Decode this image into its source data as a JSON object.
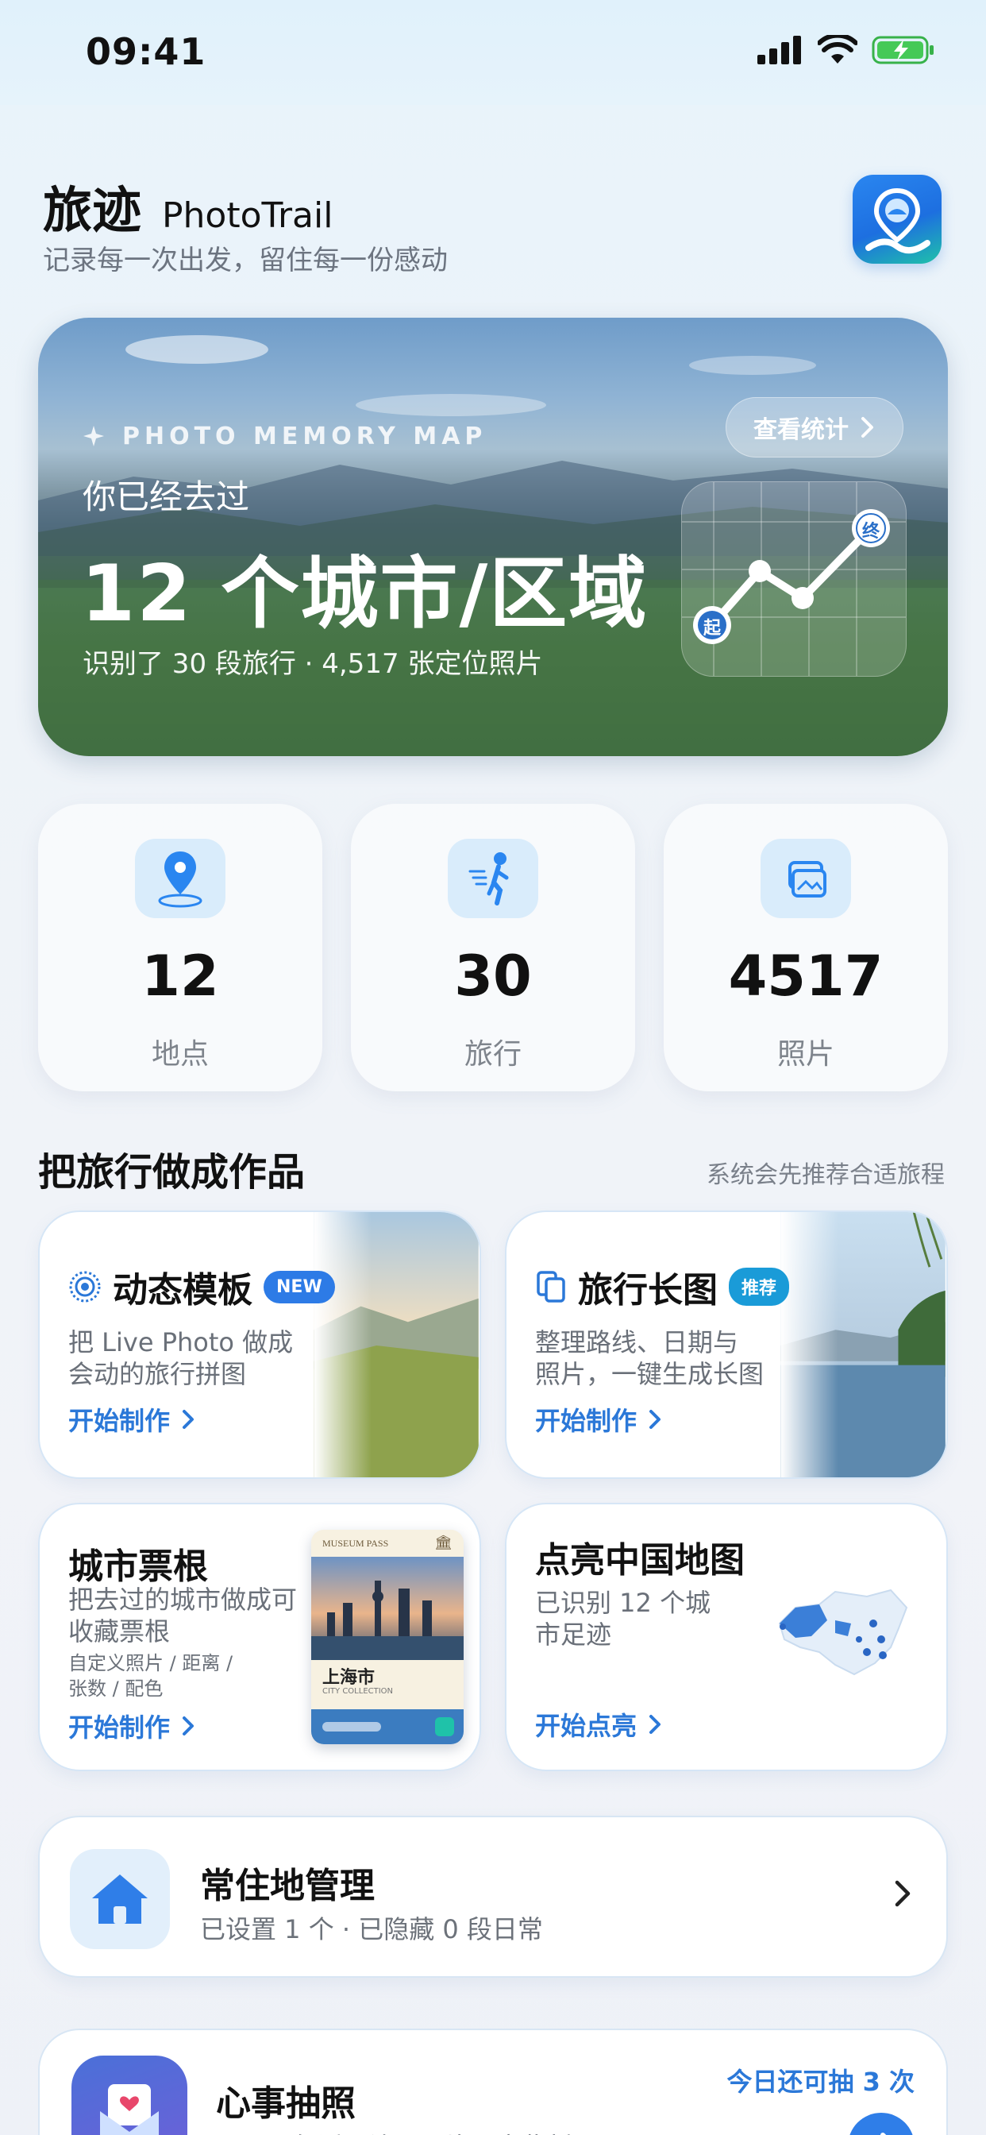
{
  "status_bar": {
    "time": "09:41"
  },
  "header": {
    "title_cn": "旅迹",
    "title_en": "PhotoTrail",
    "subtitle": "记录每一次出发，留住每一份感动",
    "logo_icon": "map-pin-logo-icon"
  },
  "hero": {
    "kicker": "PHOTO MEMORY MAP",
    "line1": "你已经去过",
    "big": "12 个城市/区域",
    "small": "识别了 30 段旅行 · 4,517 张定位照片",
    "stats_button": "查看统计",
    "route_start": "起",
    "route_end": "终"
  },
  "stats": [
    {
      "value": "12",
      "label": "地点",
      "icon": "location-pin-icon"
    },
    {
      "value": "30",
      "label": "旅行",
      "icon": "walking-person-icon"
    },
    {
      "value": "4517",
      "label": "照片",
      "icon": "photos-stack-icon"
    }
  ],
  "section": {
    "title": "把旅行做成作品",
    "hint": "系统会先推荐合适旅程"
  },
  "cards": {
    "live": {
      "title": "动态模板",
      "badge": "NEW",
      "desc1": "把 Live Photo 做成",
      "desc2": "会动的旅行拼图",
      "cta": "开始制作"
    },
    "long": {
      "title": "旅行长图",
      "badge": "推荐",
      "desc1": "整理路线、日期与",
      "desc2": "照片，一键生成长图",
      "cta": "开始制作"
    },
    "ticket": {
      "title": "城市票根",
      "desc1": "把去过的城市做成可",
      "desc2": "收藏票根",
      "note1": "自定义照片 / 距离 /",
      "note2": "张数 / 配色",
      "cta": "开始制作",
      "pass_header": "MUSEUM PASS",
      "pass_city": "上海市",
      "pass_sub": "CITY COLLECTION"
    },
    "map": {
      "title": "点亮中国地图",
      "desc1": "已识别 12 个城",
      "desc2": "市足迹",
      "cta": "开始点亮"
    }
  },
  "home": {
    "title": "常住地管理",
    "subtitle": "已设置 1 个 · 已隐藏 0 段日常"
  },
  "draw": {
    "title": "心事抽照",
    "subtitle": "写下一句话，让旧照片回应此刻",
    "remaining": "今日还可抽 3 次"
  }
}
